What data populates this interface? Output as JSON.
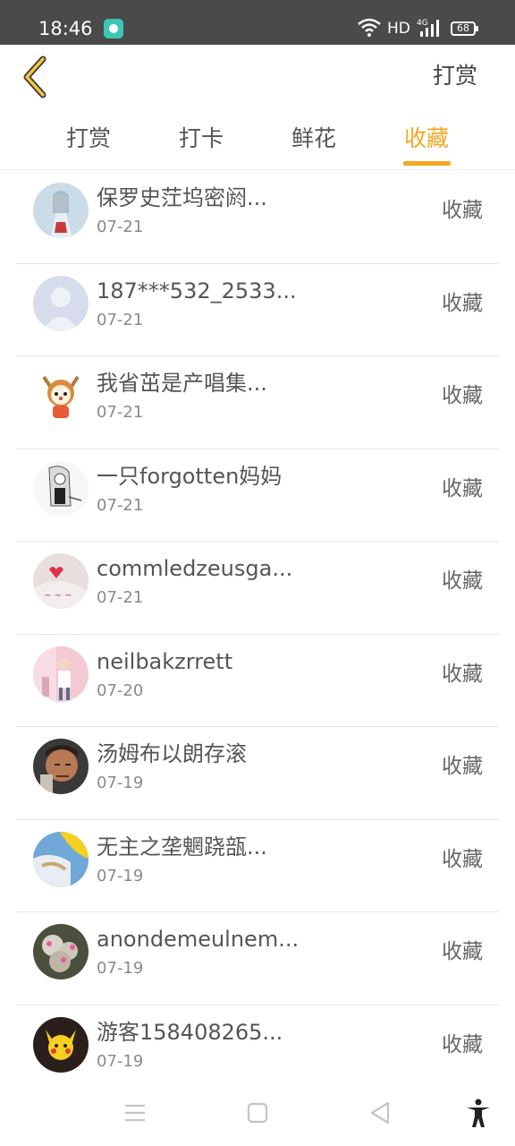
{
  "status_bar": {
    "time": "18:46",
    "network": "HD",
    "battery": "68"
  },
  "header": {
    "back_icon": "chevron-left-icon",
    "action_label": "打赏"
  },
  "tabs": [
    {
      "label": "打赏",
      "active": false
    },
    {
      "label": "打卡",
      "active": false
    },
    {
      "label": "鲜花",
      "active": false
    },
    {
      "label": "收藏",
      "active": true
    }
  ],
  "colors": {
    "accent": "#f5a623",
    "status_bar": "#4a4a4a",
    "text": "#555555",
    "subtext": "#8a8a8a"
  },
  "list": [
    {
      "name": "保罗史茳坞密阏...",
      "date": "07-21",
      "action": "收藏"
    },
    {
      "name": "187***532_2533...",
      "date": "07-21",
      "action": "收藏"
    },
    {
      "name": "我省茁是产唱集...",
      "date": "07-21",
      "action": "收藏"
    },
    {
      "name": "一只forgotten妈妈",
      "date": "07-21",
      "action": "收藏"
    },
    {
      "name": "commledzeusga...",
      "date": "07-21",
      "action": "收藏"
    },
    {
      "name": "neilbakzrrett",
      "date": "07-20",
      "action": "收藏"
    },
    {
      "name": "汤姆布以朗存滚",
      "date": "07-19",
      "action": "收藏"
    },
    {
      "name": "无主之垄魍跷瓿...",
      "date": "07-19",
      "action": "收藏"
    },
    {
      "name": "anondemeulnem...",
      "date": "07-19",
      "action": "收藏"
    },
    {
      "name": "游客158408265...",
      "date": "07-19",
      "action": "收藏"
    }
  ],
  "nav_bar": {
    "icons": [
      "menu-icon",
      "home-square-icon",
      "back-triangle-icon",
      "accessibility-icon"
    ]
  }
}
